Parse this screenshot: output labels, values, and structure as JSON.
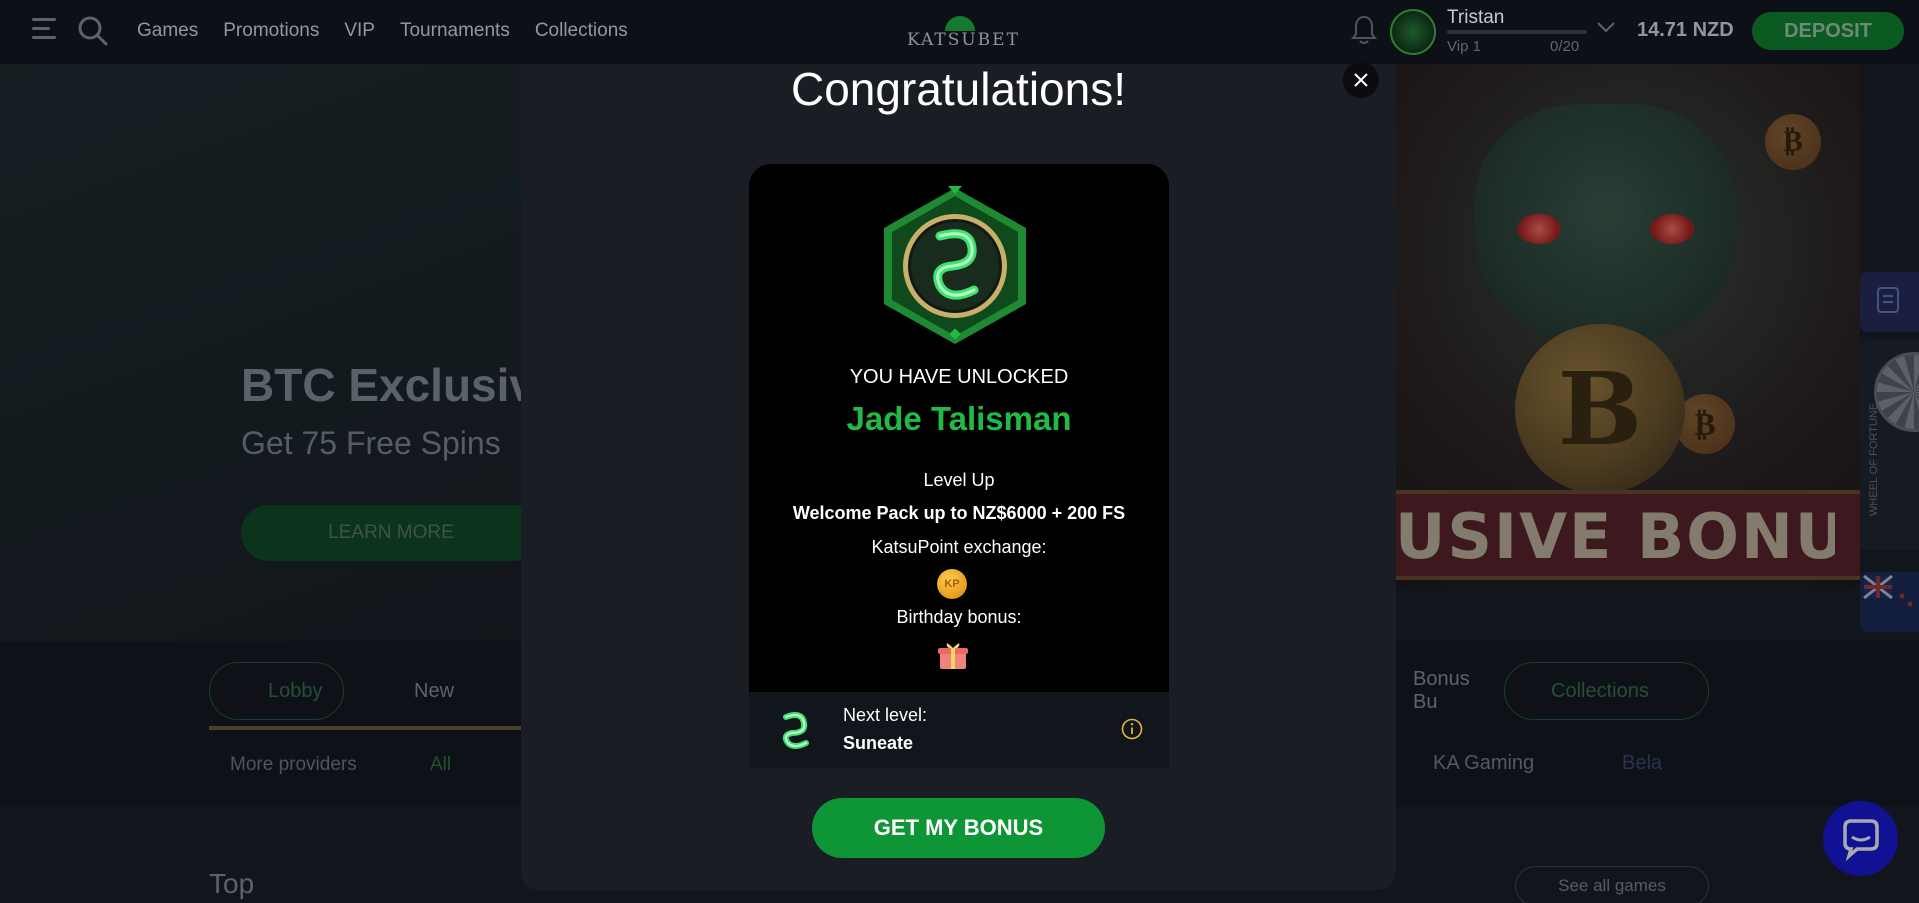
{
  "header": {
    "nav": [
      "Games",
      "Promotions",
      "VIP",
      "Tournaments",
      "Collections"
    ],
    "logo_text": "KATSUBET",
    "user": {
      "name": "Tristan",
      "vip_label": "Vip 1",
      "vip_progress": "0/20"
    },
    "balance": "14.71 NZD",
    "deposit_label": "DEPOSIT"
  },
  "hero": {
    "title": "BTC Exclusive",
    "subtitle": "Get 75 Free Spins",
    "cta_label": "LEARN MORE",
    "banner_text": "USIVE BONUS"
  },
  "side_widgets": {
    "wheel_label": "WHEEL OF FORTUNE"
  },
  "filters": {
    "chips": [
      "Lobby",
      "New",
      "Bonus Bu",
      "Collections"
    ],
    "more_providers": "More providers",
    "all_label": "All",
    "providers": [
      "KA Gaming",
      "Bela"
    ]
  },
  "sections": {
    "top_label": "Top",
    "see_all_label": "See all games"
  },
  "modal": {
    "title": "Congratulations!",
    "unlock_caption": "YOU HAVE UNLOCKED",
    "tier_name": "Jade Talisman",
    "level_up": "Level Up",
    "welcome_pack": "Welcome Pack up to NZ$6000 + 200 FS",
    "katsupoint_exchange": "KatsuPoint exchange:",
    "kp_badge": "KP",
    "birthday_bonus": "Birthday bonus:",
    "next_level_caption": "Next level:",
    "next_level_name": "Suneate",
    "cta_label": "GET MY BONUS"
  },
  "colors": {
    "accent_green": "#1fbb45",
    "button_green": "#0e9636",
    "chat_blue": "#1414d9",
    "background": "#171b22"
  },
  "icons": [
    "menu-icon",
    "search-icon",
    "bell-icon",
    "chevron-down-icon",
    "close-icon",
    "jade-talisman-icon",
    "kp-coin-icon",
    "gift-icon",
    "info-icon",
    "chat-icon",
    "task-list-icon",
    "wheel-of-fortune-icon",
    "nz-flag-icon"
  ]
}
